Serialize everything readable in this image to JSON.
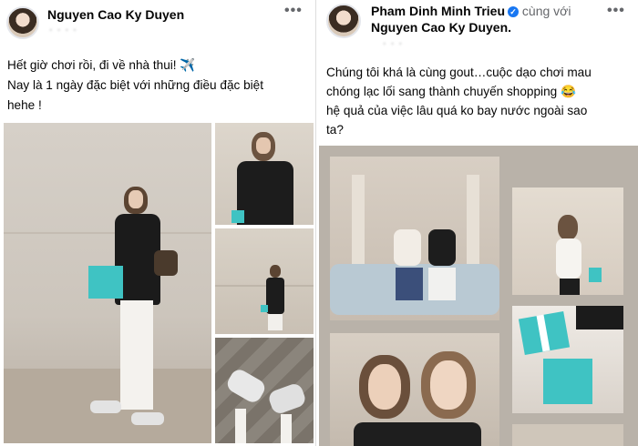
{
  "left_post": {
    "author": "Nguyen Cao Ky Duyen",
    "meta": "· · · ·",
    "more_icon": "•••",
    "line1": "Hết giờ chơi rồi, đi về nhà thui! ✈️",
    "line2": "Nay là 1 ngày đặc biệt với những điều đặc biệt",
    "line3": "hehe !"
  },
  "right_post": {
    "author": "Pham Dinh Minh Trieu",
    "verified_icon": "✓",
    "with_label": "cùng với",
    "tagged": "Nguyen Cao Ky Duyen.",
    "meta": "· · ·",
    "more_icon": "•••",
    "line1": "Chúng tôi khá là cùng gout…cuộc dạo chơi mau",
    "line2": "chóng lạc lối sang thành chuyến shopping 😂",
    "line3": "hệ quả của việc lâu quá ko bay nước ngoài sao",
    "line4": "ta?"
  },
  "colors": {
    "text": "#050505",
    "secondary": "#65676b",
    "verified": "#1877f2",
    "tiffany_blue": "#3fc3c3"
  }
}
